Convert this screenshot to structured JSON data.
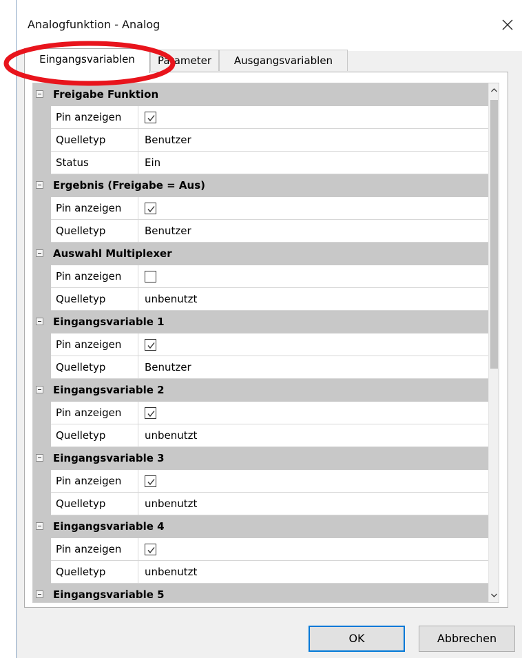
{
  "window": {
    "title": "Analogfunktion - Analog",
    "close_icon": "close-icon"
  },
  "tabs": [
    {
      "label": "Eingangsvariablen",
      "active": true
    },
    {
      "label": "Parameter",
      "active": false
    },
    {
      "label": "Ausgangsvariablen",
      "active": false
    }
  ],
  "grid": {
    "categories": [
      {
        "title": "Freigabe Funktion",
        "rows": [
          {
            "name": "Pin anzeigen",
            "checkbox": true,
            "checked": true
          },
          {
            "name": "Quelletyp",
            "value": "Benutzer"
          },
          {
            "name": "Status",
            "value": "Ein"
          }
        ]
      },
      {
        "title": "Ergebnis (Freigabe = Aus)",
        "rows": [
          {
            "name": "Pin anzeigen",
            "checkbox": true,
            "checked": true
          },
          {
            "name": "Quelletyp",
            "value": "Benutzer"
          }
        ]
      },
      {
        "title": "Auswahl Multiplexer",
        "rows": [
          {
            "name": "Pin anzeigen",
            "checkbox": true,
            "checked": false
          },
          {
            "name": "Quelletyp",
            "value": "unbenutzt"
          }
        ]
      },
      {
        "title": "Eingangsvariable 1",
        "rows": [
          {
            "name": "Pin anzeigen",
            "checkbox": true,
            "checked": true
          },
          {
            "name": "Quelletyp",
            "value": "Benutzer"
          }
        ]
      },
      {
        "title": "Eingangsvariable 2",
        "rows": [
          {
            "name": "Pin anzeigen",
            "checkbox": true,
            "checked": true
          },
          {
            "name": "Quelletyp",
            "value": "unbenutzt"
          }
        ]
      },
      {
        "title": "Eingangsvariable 3",
        "rows": [
          {
            "name": "Pin anzeigen",
            "checkbox": true,
            "checked": true
          },
          {
            "name": "Quelletyp",
            "value": "unbenutzt"
          }
        ]
      },
      {
        "title": "Eingangsvariable 4",
        "rows": [
          {
            "name": "Pin anzeigen",
            "checkbox": true,
            "checked": true
          },
          {
            "name": "Quelletyp",
            "value": "unbenutzt"
          }
        ]
      },
      {
        "title": "Eingangsvariable 5",
        "rows": []
      }
    ]
  },
  "buttons": {
    "ok_label": "OK",
    "cancel_label": "Abbrechen"
  },
  "colors": {
    "accent": "#0078d7",
    "annotation": "#e8141c",
    "category_bg": "#c8c8c8"
  }
}
